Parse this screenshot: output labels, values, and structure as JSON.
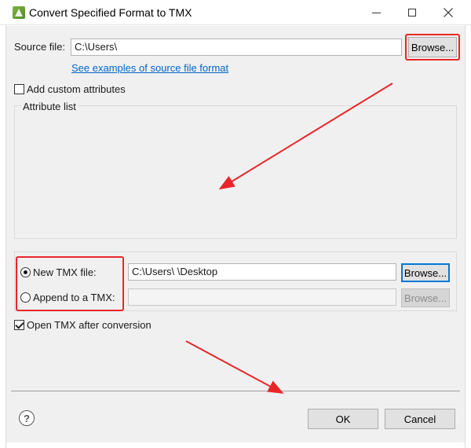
{
  "window": {
    "title": "Convert Specified Format to TMX",
    "icon": "app-icon",
    "controls": [
      "minimize-icon",
      "maximize-icon",
      "close-icon"
    ]
  },
  "source": {
    "label": "Source file:",
    "value": "C:\\Users\\",
    "browse_label": "Browse...",
    "examples_link": "See examples of source file format"
  },
  "attributes": {
    "add_custom_label": "Add custom attributes",
    "add_custom_checked": false,
    "list_label": "Attribute list"
  },
  "target": {
    "new_label": "New TMX file:",
    "new_selected": true,
    "new_value": "C:\\Users\\         \\Desktop",
    "new_browse_label": "Browse...",
    "append_label": "Append to a TMX:",
    "append_selected": false,
    "append_value": "",
    "append_browse_label": "Browse..."
  },
  "options": {
    "open_after_label": "Open TMX after conversion",
    "open_after_checked": true
  },
  "footer": {
    "help_icon": "help-icon",
    "help_glyph": "?",
    "ok_label": "OK",
    "cancel_label": "Cancel"
  },
  "annotation_color": "#e8262a"
}
